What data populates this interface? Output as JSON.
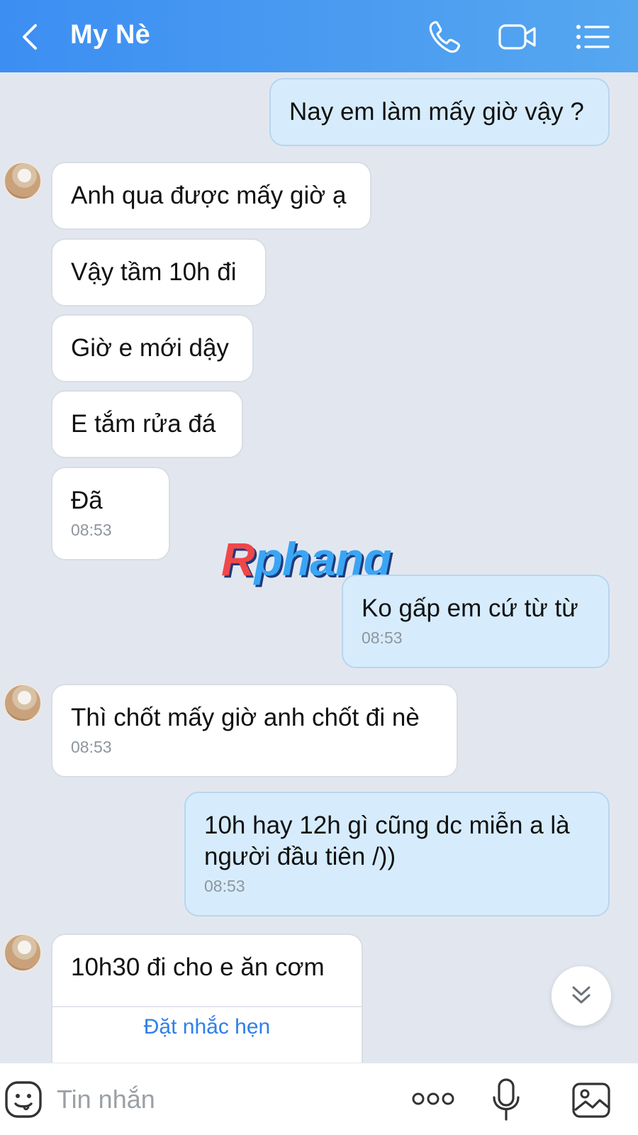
{
  "header": {
    "title": "My Nè",
    "icons": [
      "back-arrow-icon",
      "phone-icon",
      "video-camera-icon",
      "list-menu-icon"
    ]
  },
  "messages": [
    {
      "id": 1,
      "dir": "out",
      "text": "Nay em làm mấy giờ vậy ?"
    },
    {
      "id": 2,
      "dir": "in",
      "text": "Anh qua được mấy giờ ạ",
      "avatar": true
    },
    {
      "id": 3,
      "dir": "in",
      "text": "Vậy tầm 10h đi"
    },
    {
      "id": 4,
      "dir": "in",
      "text": "Giờ e mới dậy"
    },
    {
      "id": 5,
      "dir": "in",
      "text": "E tắm rửa đá"
    },
    {
      "id": 6,
      "dir": "in",
      "text": "Đã",
      "time": "08:53"
    },
    {
      "id": 7,
      "dir": "out",
      "text": "Ko gấp em cứ từ từ",
      "time": "08:53"
    },
    {
      "id": 8,
      "dir": "in",
      "text": "Thì chốt mấy giờ anh chốt đi nè",
      "time": "08:53",
      "avatar": true
    },
    {
      "id": 9,
      "dir": "out",
      "text": "10h hay 12h gì cũng dc miễn a là\nngười đầu tiên /))",
      "time": "08:53"
    },
    {
      "id": 10,
      "dir": "in",
      "text": "10h30 đi cho e ăn cơm",
      "avatar": true,
      "action": "Đặt nhắc hẹn"
    }
  ],
  "watermark": {
    "first": "R",
    "rest": "phang"
  },
  "input": {
    "placeholder": "Tin nhắn",
    "value": ""
  },
  "colors": {
    "header_start": "#3c8ef2",
    "header_end": "#56a7f0",
    "chat_background": "#e2e7ef",
    "incoming_bubble": "#ffffff",
    "outgoing_bubble": "#d6ecfc",
    "link": "#2f7fe8"
  }
}
